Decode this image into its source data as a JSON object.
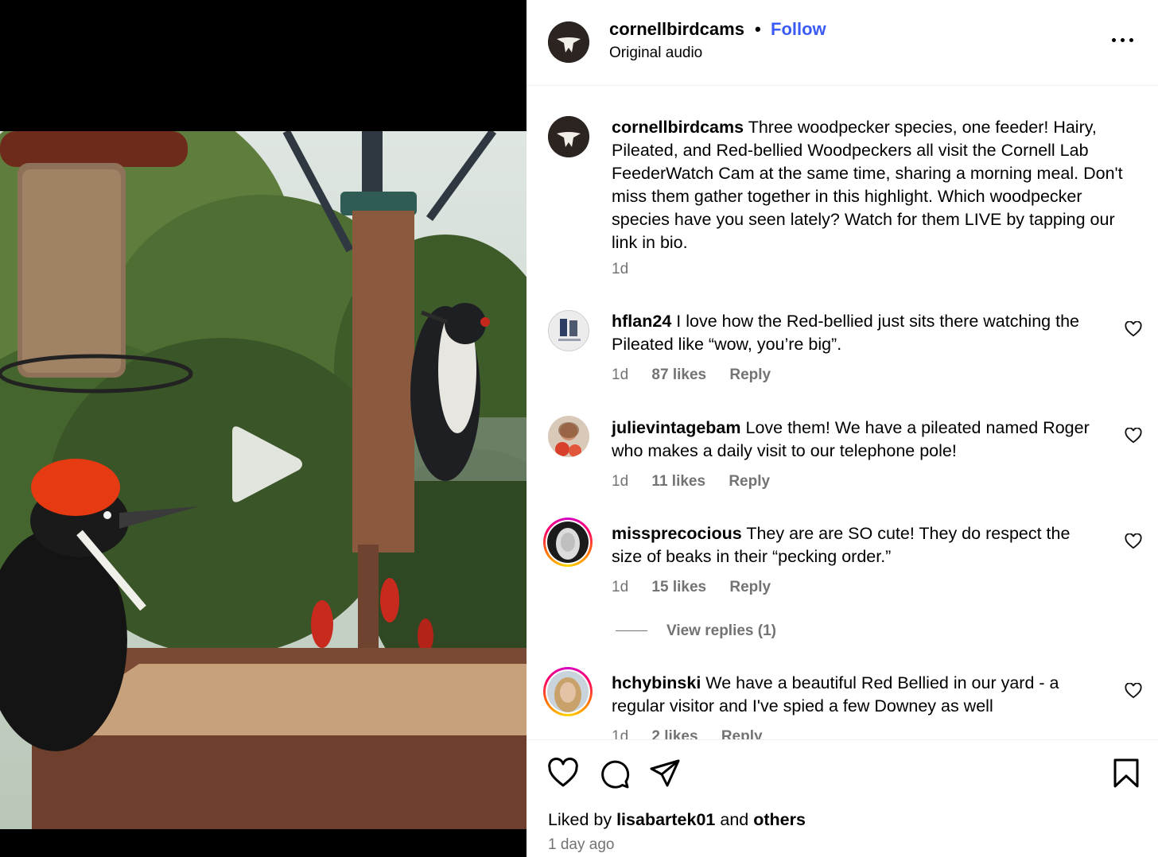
{
  "post": {
    "username": "cornellbirdcams",
    "follow_label": "Follow",
    "separator": "•",
    "audio": "Original audio",
    "more_icon": "more-horizontal-icon"
  },
  "caption": {
    "username": "cornellbirdcams",
    "text": "Three woodpecker species, one feeder! Hairy, Pileated, and Red-bellied Woodpeckers all visit the Cornell Lab FeederWatch Cam at the same time, sharing a morning meal. Don't miss them gather together in this highlight. Which woodpecker species have you seen lately? Watch for them LIVE by tapping our link in bio.",
    "time": "1d"
  },
  "comments": [
    {
      "username": "hflan24",
      "text": "I love how the Red-bellied just sits there watching the Pileated like “wow, you’re big”.",
      "time": "1d",
      "likes": "87 likes",
      "reply": "Reply"
    },
    {
      "username": "julievintagebam",
      "text": "Love them! We have a pileated named Roger who makes a daily visit to our telephone pole!",
      "time": "1d",
      "likes": "11 likes",
      "reply": "Reply"
    },
    {
      "username": "missprecocious",
      "text": "They are are SO cute! They do respect the size of beaks in their “pecking order.”",
      "time": "1d",
      "likes": "15 likes",
      "reply": "Reply",
      "view_replies": "View replies (1)"
    },
    {
      "username": "hchybinski",
      "text": "We have a beautiful Red Bellied in our yard - a regular visitor and I've spied a few Downey as well",
      "time": "1d",
      "likes": "2 likes",
      "reply": "Reply"
    }
  ],
  "footer": {
    "liked_prefix": "Liked by",
    "liked_user": "lisabartek01",
    "liked_and": "and",
    "liked_others": "others",
    "date": "1 day ago"
  },
  "icons": {
    "like": "heart-icon",
    "comment": "comment-icon",
    "share": "share-icon",
    "save": "bookmark-icon",
    "play": "play-icon"
  },
  "colors": {
    "follow": "#3b5bf6",
    "muted": "#737373",
    "divider": "#efefef"
  }
}
